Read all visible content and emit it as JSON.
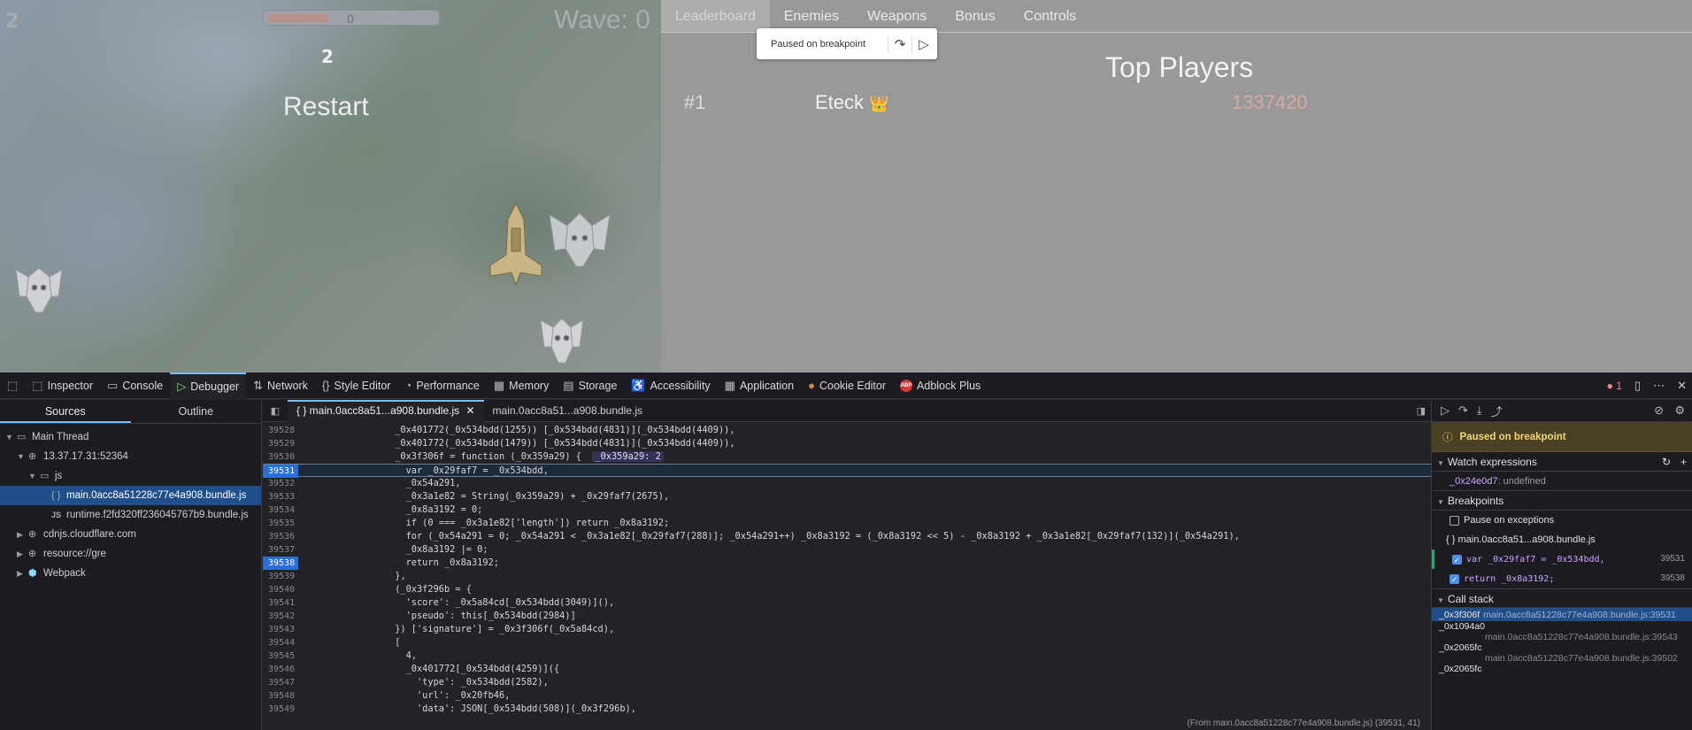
{
  "game": {
    "hud_icon": "2",
    "hp_value": "0",
    "hp_fraction": 0.36,
    "wave_label": "Wave: 0",
    "center_icon": "2",
    "restart_label": "Restart"
  },
  "panel": {
    "tabs": [
      "Leaderboard",
      "Enemies",
      "Weapons",
      "Bonus",
      "Controls"
    ],
    "active_tab": "Leaderboard",
    "title": "Top Players",
    "leaderboard": [
      {
        "rank": "#1",
        "name": "Eteck",
        "crown": "👑",
        "score": "1337420"
      }
    ]
  },
  "breakpoint_popup": {
    "text": "Paused on breakpoint",
    "step_icon": "step-over-icon",
    "resume_icon": "resume-icon"
  },
  "devtools": {
    "tabs": [
      {
        "label": "Inspector",
        "icon": "inspector-icon",
        "glyph": "⬚"
      },
      {
        "label": "Console",
        "icon": "console-icon",
        "glyph": "▭"
      },
      {
        "label": "Debugger",
        "icon": "debugger-icon",
        "glyph": "▷"
      },
      {
        "label": "Network",
        "icon": "network-icon",
        "glyph": "⇅"
      },
      {
        "label": "Style Editor",
        "icon": "style-editor-icon",
        "glyph": "{}"
      },
      {
        "label": "Performance",
        "icon": "performance-icon",
        "glyph": "◔"
      },
      {
        "label": "Memory",
        "icon": "memory-icon",
        "glyph": "▦"
      },
      {
        "label": "Storage",
        "icon": "storage-icon",
        "glyph": "▤"
      },
      {
        "label": "Accessibility",
        "icon": "accessibility-icon",
        "glyph": "♿"
      },
      {
        "label": "Application",
        "icon": "application-icon",
        "glyph": "▦"
      },
      {
        "label": "Cookie Editor",
        "icon": "cookie-icon",
        "glyph": "●"
      },
      {
        "label": "Adblock Plus",
        "icon": "adblock-icon",
        "glyph": "ABP"
      }
    ],
    "active_tab": "Debugger",
    "error_count": "1",
    "colors": {
      "accent": "#75bfff",
      "selection": "#204e8a",
      "error": "#ff848a"
    }
  },
  "sources": {
    "tabs": [
      "Sources",
      "Outline"
    ],
    "tree": [
      {
        "label": "Main Thread",
        "depth": 0,
        "arrow": "▼",
        "icon": "window-icon",
        "glyph": "▭"
      },
      {
        "label": "13.37.17.31:52364",
        "depth": 1,
        "arrow": "▼",
        "icon": "globe-icon",
        "glyph": "⊕"
      },
      {
        "label": "js",
        "depth": 2,
        "arrow": "▼",
        "icon": "folder-icon",
        "glyph": "▭"
      },
      {
        "label": "main.0acc8a51228c77e4a908.bundle.js",
        "depth": 3,
        "arrow": "",
        "icon": "braces-icon",
        "glyph": "{ }",
        "selected": true
      },
      {
        "label": "runtime.f2fd320ff236045767b9.bundle.js",
        "depth": 3,
        "arrow": "",
        "icon": "js-file-icon",
        "glyph": "JS"
      },
      {
        "label": "cdnjs.cloudflare.com",
        "depth": 1,
        "arrow": "▶",
        "icon": "globe-icon",
        "glyph": "⊕"
      },
      {
        "label": "resource://gre",
        "depth": 1,
        "arrow": "▶",
        "icon": "globe-icon",
        "glyph": "⊕"
      },
      {
        "label": "Webpack",
        "depth": 1,
        "arrow": "▶",
        "icon": "webpack-icon",
        "glyph": "⬢"
      }
    ]
  },
  "editor": {
    "tabs": [
      {
        "label": "{ } main.0acc8a51...a908.bundle.js",
        "active": true
      },
      {
        "label": "main.0acc8a51...a908.bundle.js",
        "active": false
      }
    ],
    "lines": [
      {
        "n": "39528",
        "code": "                _0x401772(_0x534bdd(1255)) [_0x534bdd(4831)](_0x534bdd(4409)),"
      },
      {
        "n": "39529",
        "code": "                _0x401772(_0x534bdd(1479)) [_0x534bdd(4831)](_0x534bdd(4409)),"
      },
      {
        "n": "39530",
        "code": "                _0x3f306f = function (_0x359a29) {  ",
        "preview": "_0x359a29: 2"
      },
      {
        "n": "39531",
        "code": "                  var _0x29faf7 = _0x534bdd,",
        "bp": true,
        "paused": true
      },
      {
        "n": "39532",
        "code": "                  _0x54a291,"
      },
      {
        "n": "39533",
        "code": "                  _0x3a1e82 = String(_0x359a29) + _0x29faf7(2675),"
      },
      {
        "n": "39534",
        "code": "                  _0x8a3192 = 0;"
      },
      {
        "n": "39535",
        "code": "                  if (0 === _0x3a1e82['length']) return _0x8a3192;"
      },
      {
        "n": "39536",
        "code": "                  for (_0x54a291 = 0; _0x54a291 < _0x3a1e82[_0x29faf7(288)]; _0x54a291++) _0x8a3192 = (_0x8a3192 << 5) - _0x8a3192 + _0x3a1e82[_0x29faf7(132)](_0x54a291),"
      },
      {
        "n": "39537",
        "code": "                  _0x8a3192 |= 0;"
      },
      {
        "n": "39538",
        "code": "                  return _0x8a3192;",
        "bp": true
      },
      {
        "n": "39539",
        "code": "                },"
      },
      {
        "n": "39540",
        "code": "                (_0x3f296b = {"
      },
      {
        "n": "39541",
        "code": "                  'score': _0x5a84cd[_0x534bdd(3049)](),"
      },
      {
        "n": "39542",
        "code": "                  'pseudo': this[_0x534bdd(2984)]"
      },
      {
        "n": "39543",
        "code": "                }) ['signature'] = _0x3f306f(_0x5a84cd),"
      },
      {
        "n": "39544",
        "code": "                ["
      },
      {
        "n": "39545",
        "code": "                  4,"
      },
      {
        "n": "39546",
        "code": "                  _0x401772[_0x534bdd(4259)]({"
      },
      {
        "n": "39547",
        "code": "                    'type': _0x534bdd(2582),"
      },
      {
        "n": "39548",
        "code": "                    'url': _0x20fb46,"
      },
      {
        "n": "39549",
        "code": "                    'data': JSON[_0x534bdd(508)](_0x3f296b),"
      }
    ],
    "status": "(From main.0acc8a51228c77e4a908.bundle.js)  (39531, 41)"
  },
  "right": {
    "paused_label": "Paused on breakpoint",
    "watch_title": "Watch expressions",
    "watch": [
      {
        "expr": "_0x24e0d7",
        "value": "undefined"
      }
    ],
    "breakpoints_title": "Breakpoints",
    "pause_exceptions": "Pause on exceptions",
    "bp_file": "main.0acc8a51...a908.bundle.js",
    "breakpoints": [
      {
        "code": "var _0x29faf7 = _0x534bdd,",
        "line": "39531"
      },
      {
        "code": "return _0x8a3192;",
        "line": "39538"
      }
    ],
    "callstack_title": "Call stack",
    "frames": [
      {
        "fn": "_0x3f306f",
        "loc": "main.0acc8a51228c77e4a908.bundle.js:39531",
        "selected": true
      },
      {
        "fn": "_0x1094a0",
        "loc": "main.0acc8a51228c77e4a908.bundle.js:39543"
      },
      {
        "fn": "_0x2065fc",
        "loc": "main.0acc8a51228c77e4a908.bundle.js:39502"
      },
      {
        "fn": "_0x2065fc",
        "loc": ""
      }
    ]
  }
}
